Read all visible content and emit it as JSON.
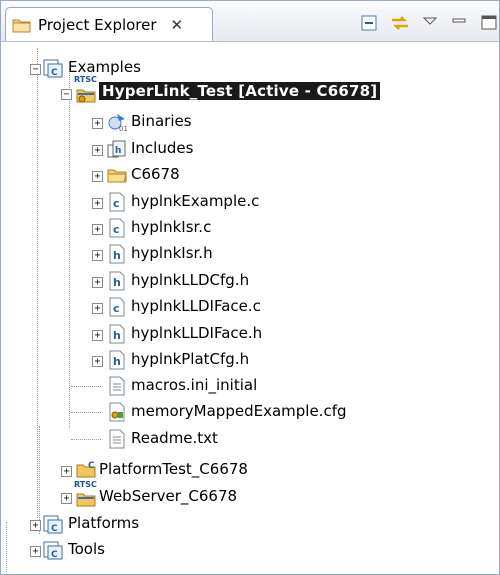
{
  "view": {
    "title": "Project Explorer",
    "close_glyph": "✕",
    "toolbar": [
      "collapse-all-icon",
      "link-with-editor-icon",
      "view-menu-icon",
      "minimize-icon",
      "maximize-icon"
    ]
  },
  "tree": {
    "examples": "Examples",
    "hyperlink_test": "HyperLink_Test  [Active - C6678]",
    "rtsc_badge": "RTSC",
    "binaries": "Binaries",
    "includes": "Includes",
    "c6678": "C6678",
    "files": [
      "hyplnkExample.c",
      "hyplnkIsr.c",
      "hyplnkIsr.h",
      "hyplnkLLDCfg.h",
      "hyplnkLLDIFace.c",
      "hyplnkLLDIFace.h",
      "hyplnkPlatCfg.h",
      "macros.ini_initial",
      "memoryMappedExample.cfg",
      "Readme.txt"
    ],
    "platformtest": "PlatformTest_C6678",
    "webserver": "WebServer_C6678",
    "platforms": "Platforms",
    "tools": "Tools"
  }
}
